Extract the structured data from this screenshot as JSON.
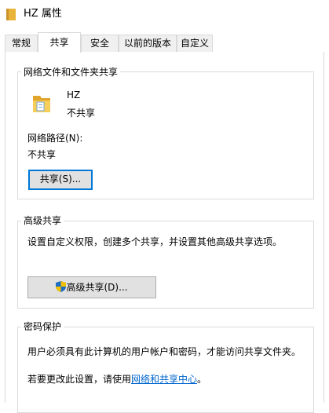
{
  "window": {
    "title": "HZ 属性",
    "title_icon": "folder-icon"
  },
  "tabs": [
    {
      "label": "常规",
      "active": false
    },
    {
      "label": "共享",
      "active": true
    },
    {
      "label": "安全",
      "active": false
    },
    {
      "label": "以前的版本",
      "active": false
    },
    {
      "label": "自定义",
      "active": false
    }
  ],
  "network_sharing": {
    "title": "网络文件和文件夹共享",
    "folder_name": "HZ",
    "folder_status": "不共享",
    "path_label": "网络路径(N):",
    "path_value": "不共享",
    "share_button": "共享(S)..."
  },
  "advanced_sharing": {
    "title": "高级共享",
    "description": "设置自定义权限，创建多个共享，并设置其他高级共享选项。",
    "button": "高级共享(D)...",
    "button_icon": "uac-shield-icon"
  },
  "password_protection": {
    "title": "密码保护",
    "description": "用户必须具有此计算机的用户帐户和密码，才能访问共享文件夹。",
    "change_prefix": "若要更改此设置，请使用",
    "change_link": "网络和共享中心",
    "change_suffix": "。"
  },
  "colors": {
    "accent": "#0078d7",
    "link": "#0066cc",
    "folder": "#f4c542"
  }
}
